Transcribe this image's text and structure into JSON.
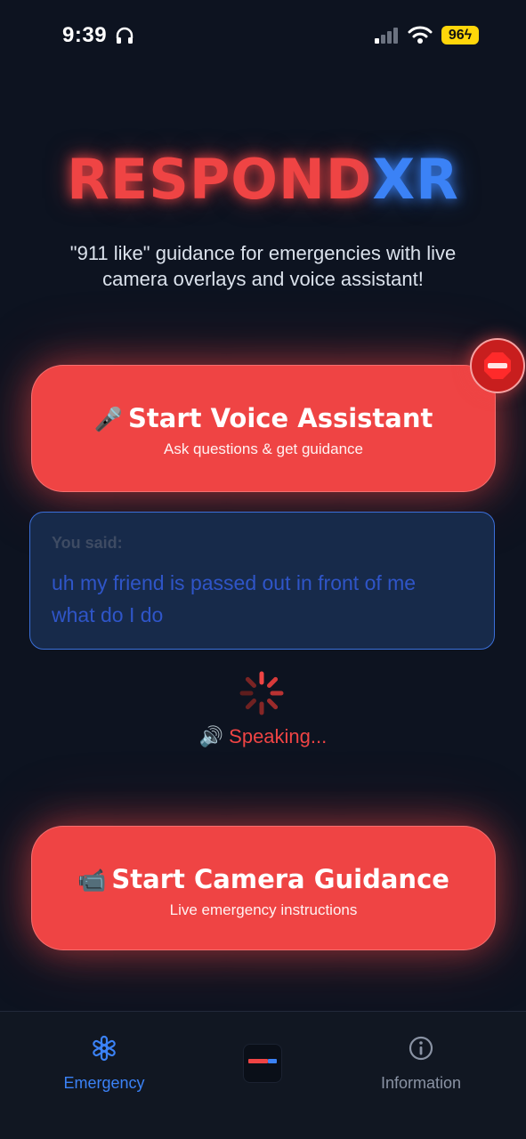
{
  "status_bar": {
    "time": "9:39",
    "battery": "96"
  },
  "hero": {
    "logo_part_a": "RESPOND",
    "logo_part_b": "XR",
    "tagline_line1": "\"911 like\" guidance for emergencies with live",
    "tagline_line2": "camera overlays and voice assistant!"
  },
  "voice_button": {
    "icon": "🎤",
    "label": "Start Voice Assistant",
    "sub": "Ask questions & get guidance"
  },
  "stop_button": {
    "icon": "stop-sign-icon"
  },
  "transcript": {
    "label": "You said:",
    "text_line1": "uh my friend is passed out in front of me",
    "text_line2": "what do I do"
  },
  "status": {
    "icon": "🔊",
    "text": "Speaking..."
  },
  "camera_button": {
    "icon": "📹",
    "label": "Start Camera Guidance",
    "sub": "Live emergency instructions"
  },
  "tabs": [
    {
      "label": "Emergency",
      "icon": "asterisk-icon",
      "active": true
    },
    {
      "label": "",
      "icon": "app-logo-icon",
      "active": false
    },
    {
      "label": "Information",
      "icon": "info-icon",
      "active": false
    }
  ],
  "colors": {
    "accent_red": "#ef4444",
    "accent_blue": "#3b82f6",
    "background": "#0d1320"
  }
}
